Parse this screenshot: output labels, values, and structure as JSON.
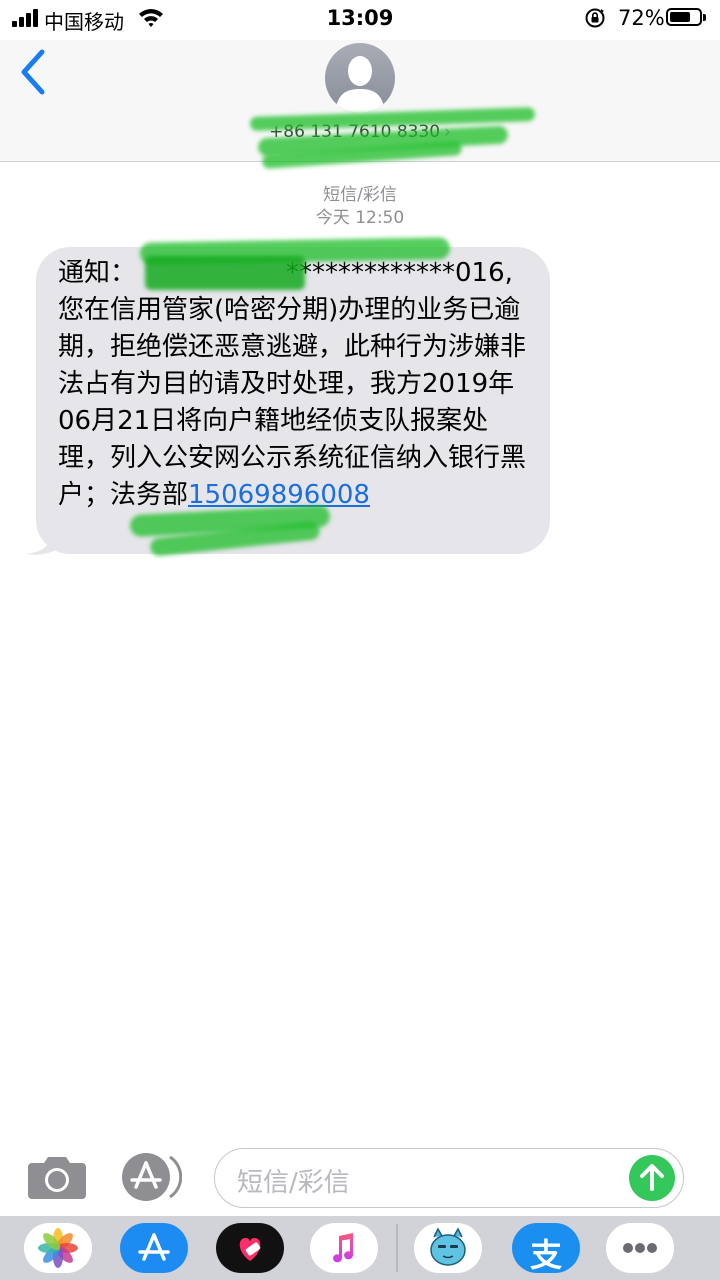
{
  "status": {
    "carrier": "中国移动",
    "time": "13:09",
    "battery": "72%",
    "battery_level": 0.72
  },
  "header": {
    "contact": "+86 131 7610 8330",
    "chevron": "›"
  },
  "conversation": {
    "kind": "短信/彩信",
    "timestamp": "今天 12:50",
    "message": {
      "prefix": "通知：",
      "masked": "*************016,",
      "body": "您在信用管家(哈密分期)办理的业务已逾期，拒绝偿还恶意逃避，此种行为涉嫌非法占有为目的请及时处理，我方2019年06月21日将向户籍地经侦支队报案处理，列入公安网公示系统征信纳入银行黑户；法务部",
      "phone_link": "15069896008"
    }
  },
  "input": {
    "placeholder": "短信/彩信"
  },
  "drawer": {
    "apps": [
      {
        "name": "photos-app-icon"
      },
      {
        "name": "app-store-app-icon"
      },
      {
        "name": "digital-touch-app-icon"
      },
      {
        "name": "music-app-icon"
      },
      {
        "name": "sticker-app-icon"
      },
      {
        "name": "alipay-app-icon",
        "glyph": "支"
      },
      {
        "name": "more-apps-icon"
      }
    ]
  },
  "colors": {
    "accent_blue": "#1a7cf5",
    "bubble_gray": "#e5e5ea",
    "send_green": "#34c759",
    "redaction_green": "#22c033"
  }
}
